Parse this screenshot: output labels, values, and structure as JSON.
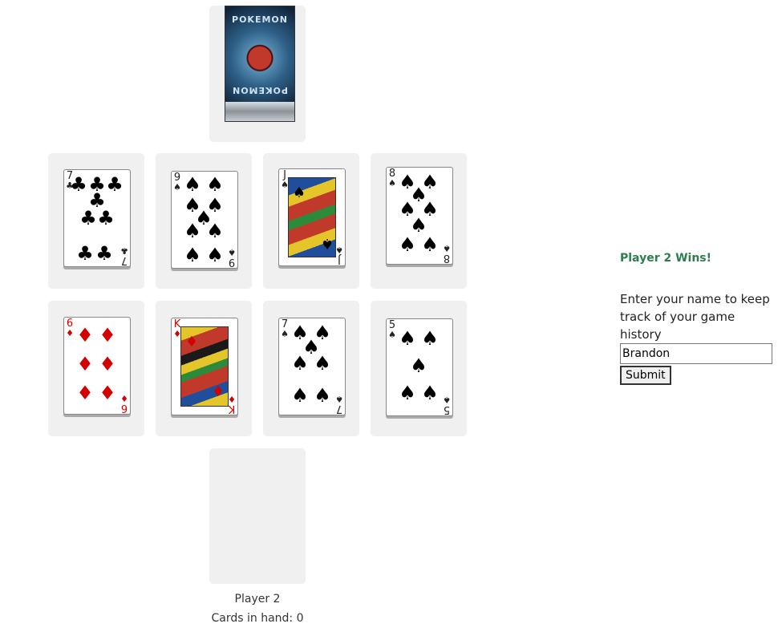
{
  "deck": {
    "top_label": "POKEMON",
    "bottom_label": "POKEMON"
  },
  "table": {
    "cards": [
      {
        "rank": "7",
        "suit": "♣",
        "color": "#000000"
      },
      {
        "rank": "9",
        "suit": "♠",
        "color": "#000000"
      },
      {
        "rank": "J",
        "suit": "♠",
        "color": "#000000"
      },
      {
        "rank": "8",
        "suit": "♠",
        "color": "#000000"
      },
      {
        "rank": "6",
        "suit": "♦",
        "color": "#d40000"
      },
      {
        "rank": "K",
        "suit": "♦",
        "color": "#d40000"
      },
      {
        "rank": "7",
        "suit": "♠",
        "color": "#000000"
      },
      {
        "rank": "5",
        "suit": "♠",
        "color": "#000000"
      }
    ]
  },
  "player": {
    "name": "Player 2",
    "cards_label": "Cards in hand: 0"
  },
  "result": {
    "message": "Player 2 Wins!"
  },
  "form": {
    "prompt": "Enter your name to keep track of your game history",
    "name_value": "Brandon",
    "submit_label": "Submit"
  }
}
